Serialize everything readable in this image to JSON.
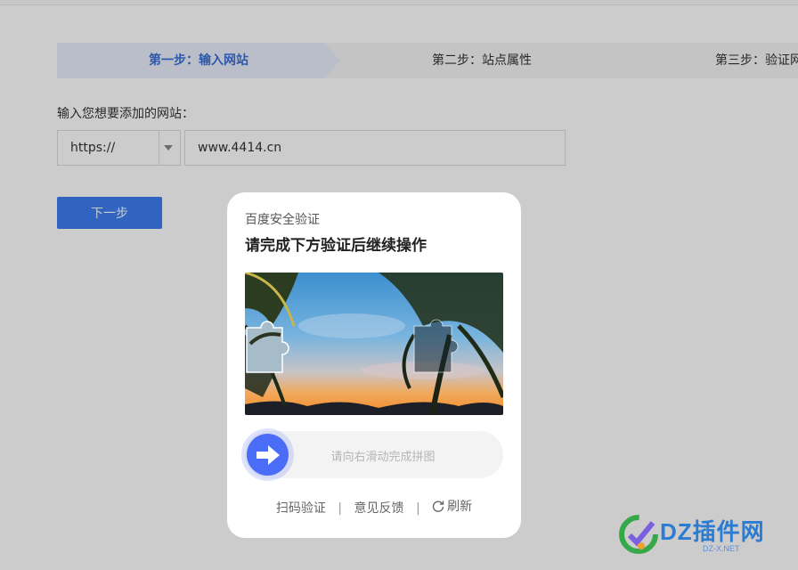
{
  "steps": [
    {
      "label": "第一步：输入网站",
      "active": true
    },
    {
      "label": "第二步：站点属性",
      "active": false
    },
    {
      "label": "第三步：验证网",
      "active": false
    }
  ],
  "form": {
    "label": "输入您想要添加的网站：",
    "protocol": "https://",
    "url_value": "www.4414.cn",
    "next_button": "下一步"
  },
  "captcha": {
    "brand": "百度安全验证",
    "title": "请完成下方验证后继续操作",
    "slider_hint": "请向右滑动完成拼图",
    "footer": {
      "qr_label": "扫码验证",
      "separator": "|",
      "feedback_label": "意见反馈",
      "refresh_label": "刷新"
    }
  },
  "watermark": {
    "brand": "DZ插件网",
    "domain": "DZ-X.NET"
  },
  "colors": {
    "accent": "#3d7ef0",
    "slider": "#4a6cf7",
    "overlay": "rgba(0,0,0,0.2)"
  }
}
